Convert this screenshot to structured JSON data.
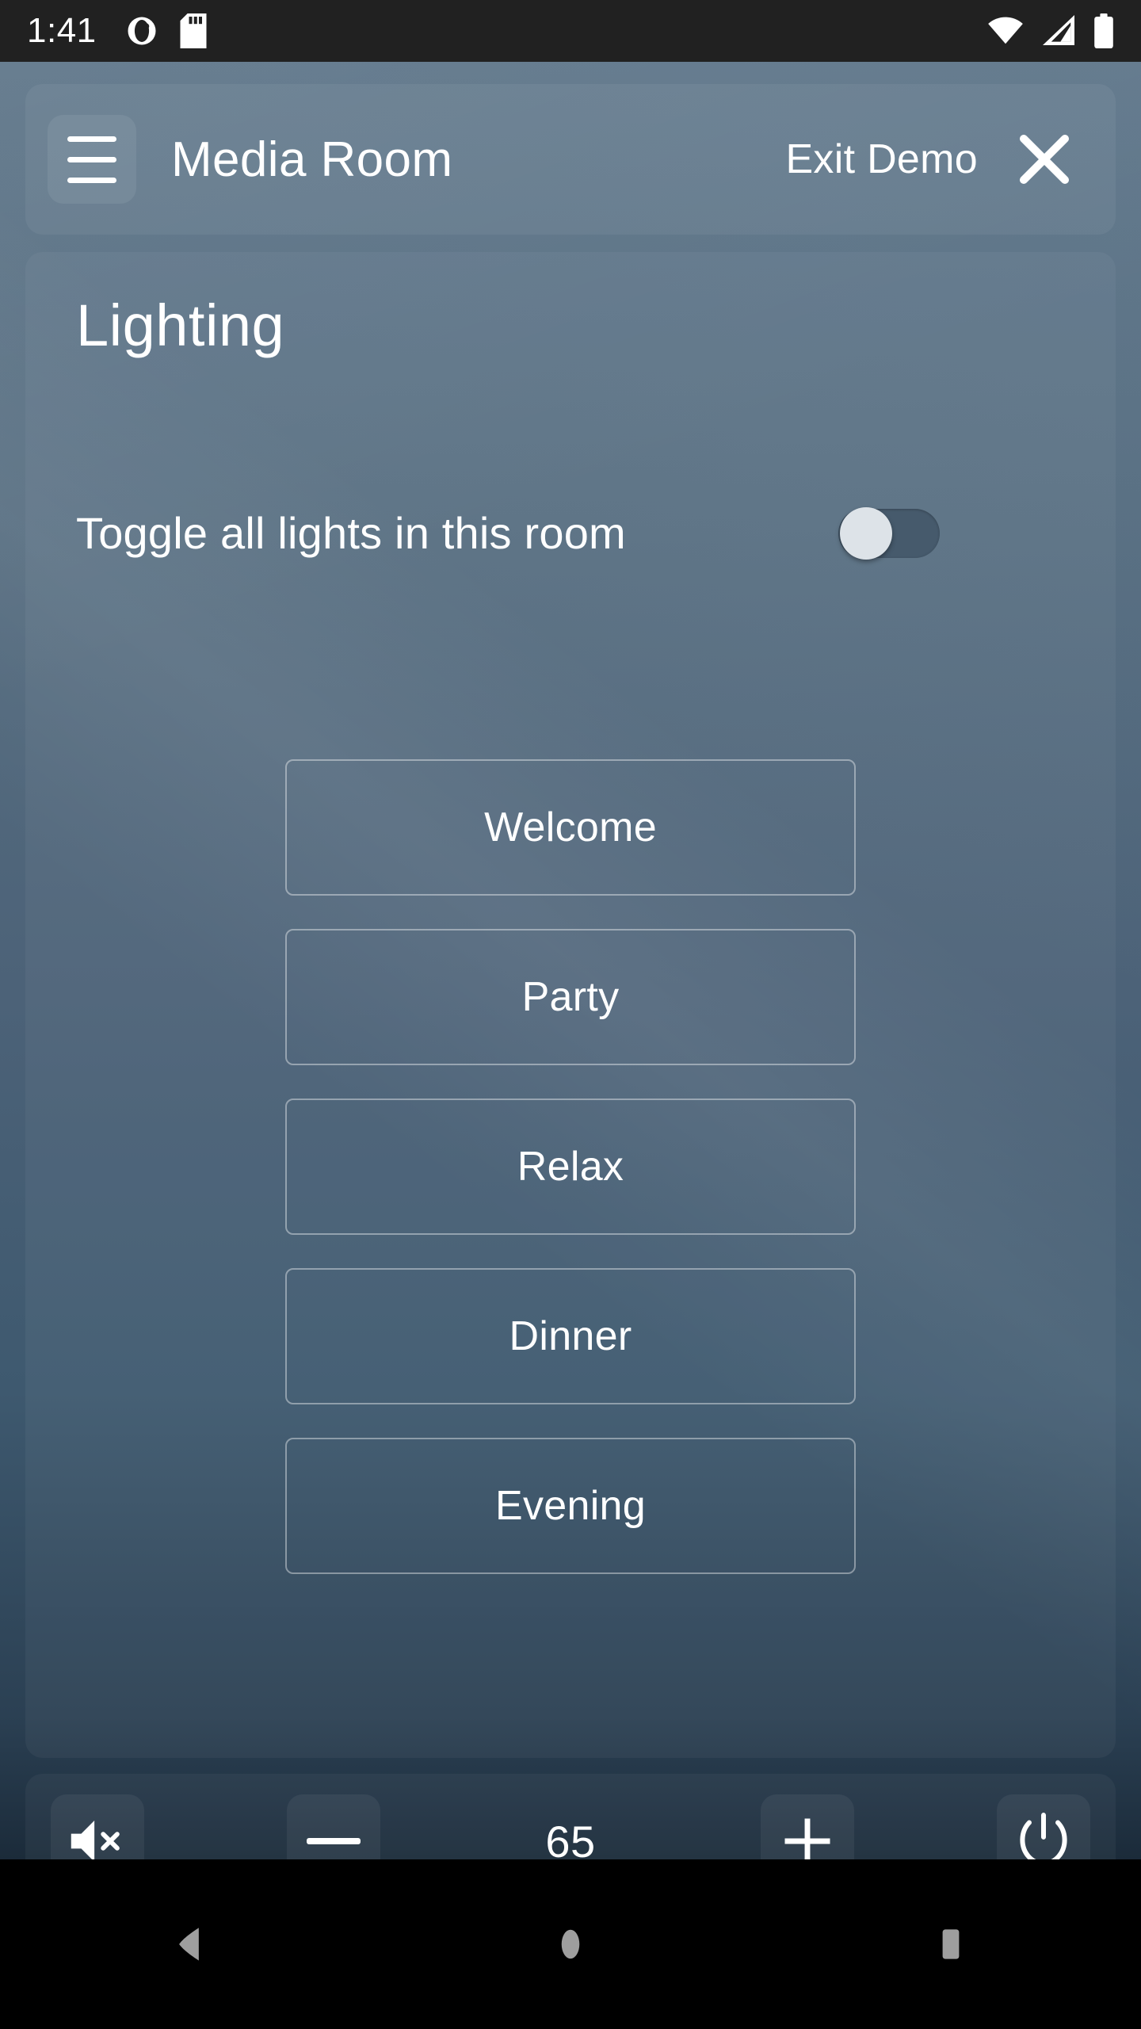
{
  "statusbar": {
    "clock": "1:41",
    "left_icons": [
      "contrast-circle-icon",
      "sd-card-icon"
    ],
    "right_icons": [
      "wifi-icon",
      "cellular-signal-icon",
      "battery-full-icon"
    ]
  },
  "header": {
    "menu_icon": "hamburger-menu-icon",
    "room_title": "Media Room",
    "exit_label": "Exit Demo",
    "close_icon": "close-x-icon"
  },
  "content": {
    "section_title": "Lighting",
    "toggle": {
      "label": "Toggle all lights in this room",
      "state": "off"
    },
    "scenes": [
      {
        "label": "Welcome"
      },
      {
        "label": "Party"
      },
      {
        "label": "Relax"
      },
      {
        "label": "Dinner"
      },
      {
        "label": "Evening"
      }
    ]
  },
  "controlbar": {
    "mute_icon": "volume-mute-icon",
    "minus_icon": "minus-icon",
    "volume_value": "65",
    "plus_icon": "plus-icon",
    "power_icon": "power-icon"
  },
  "navbar": {
    "back_icon": "back-triangle-icon",
    "home_icon": "home-circle-icon",
    "recents_icon": "recents-square-icon"
  },
  "colors": {
    "statusbar_bg": "#212121",
    "app_bg_top": "#5e7588",
    "app_bg_bottom": "#1b2b3a",
    "text": "#ffffff",
    "navbar_bg": "#000000",
    "nav_icon": "#9e9e9e",
    "switch_knob": "#dde3e8"
  }
}
